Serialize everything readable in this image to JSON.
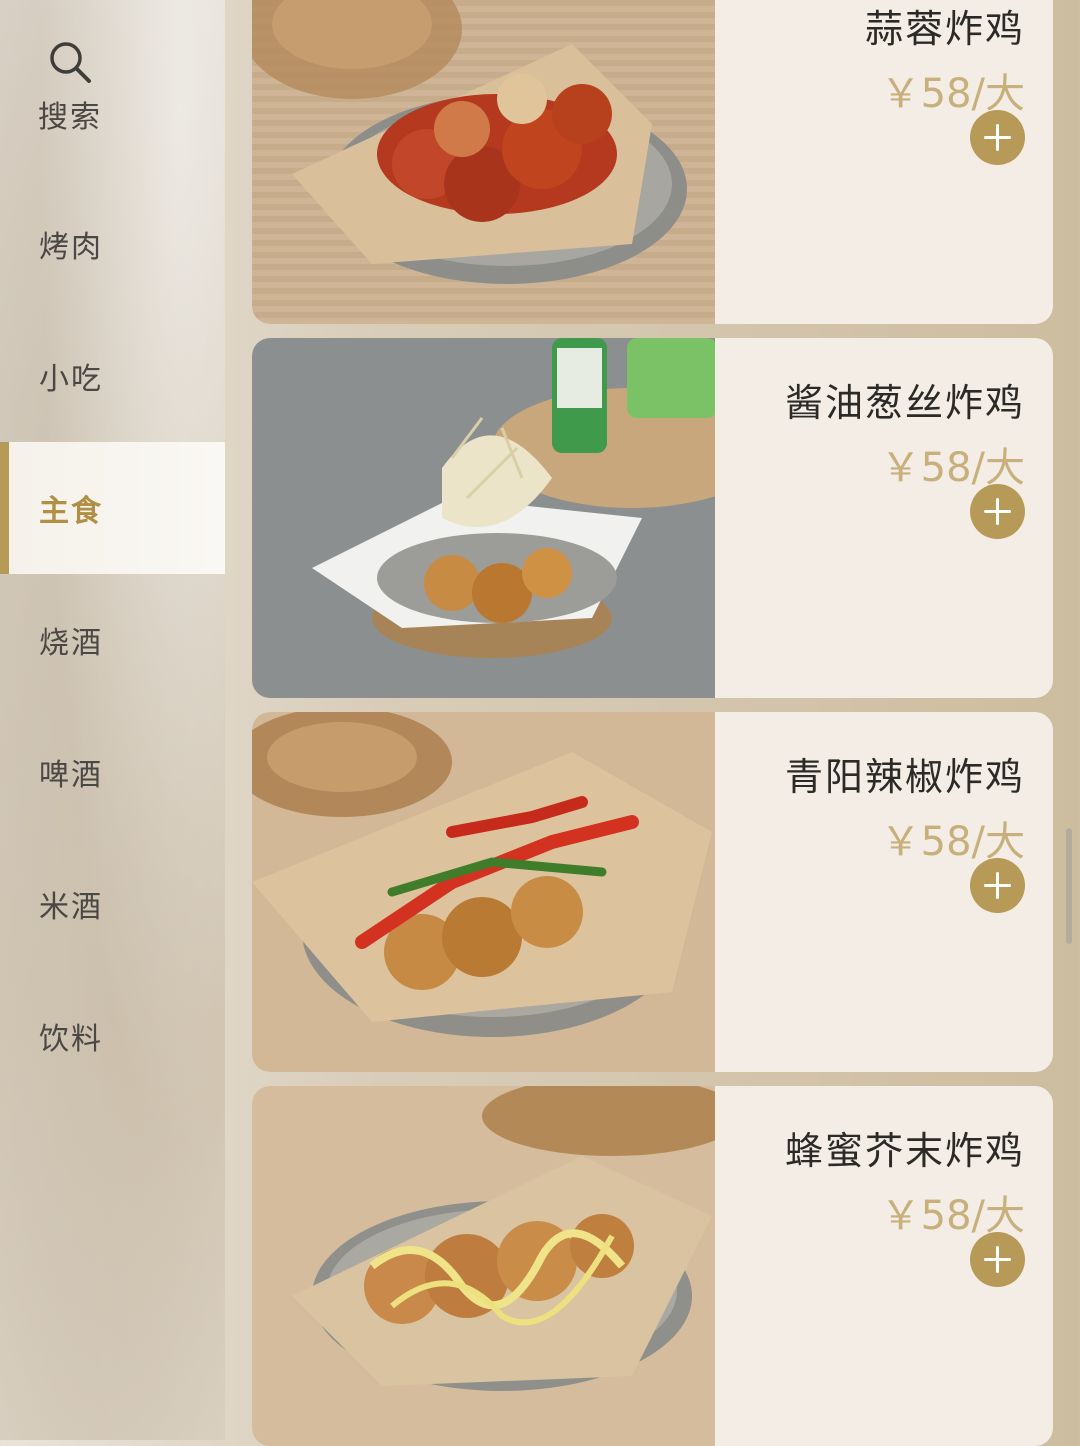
{
  "sidebar": {
    "search_label": "搜索",
    "items": [
      {
        "label": "烤肉"
      },
      {
        "label": "小吃"
      },
      {
        "label": "主食",
        "active": true
      },
      {
        "label": "烧酒"
      },
      {
        "label": "啤酒"
      },
      {
        "label": "米酒"
      },
      {
        "label": "饮料"
      }
    ]
  },
  "menu": {
    "items": [
      {
        "name": "蒜蓉炸鸡",
        "price": "￥58/大",
        "icon": "plus-icon"
      },
      {
        "name": "酱油葱丝炸鸡",
        "price": "￥58/大",
        "icon": "plus-icon"
      },
      {
        "name": "青阳辣椒炸鸡",
        "price": "￥58/大",
        "icon": "plus-icon"
      },
      {
        "name": "蜂蜜芥末炸鸡",
        "price": "￥58/大",
        "icon": "plus-icon"
      }
    ]
  },
  "colors": {
    "accent": "#b79a57",
    "price": "#c7b07c",
    "active_nav": "#b18f45",
    "card_bg": "#f3ede5"
  }
}
